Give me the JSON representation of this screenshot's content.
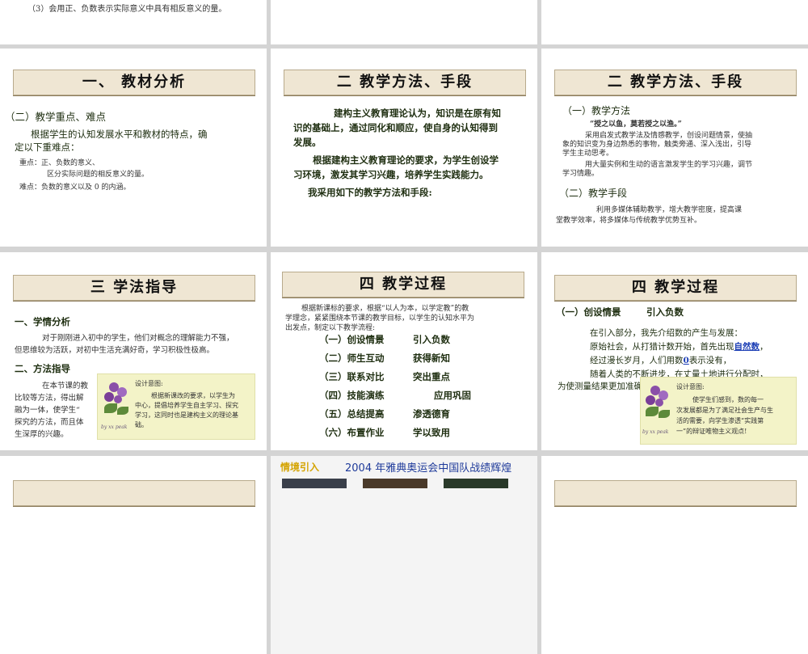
{
  "r0": {
    "line": "（3）会用正、负数表示实际意义中具有相反意义的量。"
  },
  "s1": {
    "title": "一、 教材分析",
    "heading": "（二）教学重点、难点",
    "p1": "根据学生的认知发展水平和教材的特点，确",
    "p2": "定以下重难点：",
    "k1": "重点：正、负数的意义、",
    "k2": "区分实际问题的相反意义的量。",
    "k3": "难点：负数的意义以及 0 的内涵。"
  },
  "s2": {
    "title": "二 教学方法、手段",
    "l1": "建构主义教育理论认为，知识是在原有知",
    "l2": "识的基础上，通过同化和顺应，使自身的认知得到",
    "l3": "发展。",
    "l4": "根据建构主义教育理论的要求，为学生创设学",
    "l5": "习环境，激发其学习兴趣，培养学生实践能力。",
    "l6": "我采用如下的教学方法和手段:"
  },
  "s3": {
    "title": "二 教学方法、手段",
    "h1": "（一）教学方法",
    "q": "“授之以鱼，莫若授之以渔。”",
    "a1": "采用启发式教学法及情感教学，创设问题情景，使抽",
    "a2": "象的知识变为身边熟悉的事物，触类旁通、深入浅出，引导",
    "a3": "学生主动思考。",
    "a4": "用大量实例和生动的语言激发学生的学习兴趣，调节",
    "a5": "学习情趣。",
    "h2": "（二）教学手段",
    "b1": "利用多媒体辅助教学，增大教学密度，提高课",
    "b2": "堂教学效率，将多媒体与传统教学优势互补。"
  },
  "s4": {
    "title": "三 学法指导",
    "h1": "一、学情分析",
    "p1": "对于刚刚进入初中的学生，他们对概念的理解能力不强，",
    "p2": "但思维较为活跃，对初中生活充满好奇，学习积极性极高。",
    "h2": "二、方法指导",
    "m1": "在本节课的教",
    "m2": "比较等方法，得出解",
    "m3": "融为一体，使学生“",
    "m4": "探究的方法，而且体",
    "m5": "生深厚的兴趣。",
    "note_title": "设计意图:",
    "note1": "根据新课改的要求，以学生为",
    "note2": "中心，提倡培养学生自主学习、探究",
    "note3": "学习，这同时也是建构主义的理论基",
    "note4": "础。",
    "sig": "by xx peak"
  },
  "s5": {
    "title": "四 教学过程",
    "i1": "根据新课标的要求，根据“以人为本，以学定教”的教",
    "i2": "学理念，紧紧围绕本节课的教学目标，以学生的认知水平为",
    "i3": "出发点，制定以下教学流程:",
    "steps": [
      {
        "n": "（一）创设情景",
        "d": "引入负数"
      },
      {
        "n": "（二）师生互动",
        "d": "获得新知"
      },
      {
        "n": "（三）联系对比",
        "d": "突出重点"
      },
      {
        "n": "（四）技能演练",
        "d": "应用巩固"
      },
      {
        "n": "（五）总结提高",
        "d": "渗透德育"
      },
      {
        "n": "（六）布置作业",
        "d": "学以致用"
      }
    ]
  },
  "s6": {
    "title": "四 教学过程",
    "h": "（一）创设情景",
    "h2": "引入负数",
    "l1": "在引入部分，我先介绍数的产生与发展：",
    "l2a": "原始社会，从打猎计数开始，首先出现",
    "l2b": "自然数",
    "l2c": "，",
    "l3a": "经过漫长岁月，人们用数",
    "l3b": "0",
    "l3c": "表示没有，",
    "l4": "随着人类的不断进步，在丈量土地进行分配时，",
    "l5": "为使测量结果更加准确",
    "note_title": "设计意图:",
    "note1": "使学生们感到，数的每一",
    "note2": "次发展都是为了满足社会生产与生",
    "note3": "活的需要，向学生渗透“实践第",
    "note4": "一”的辩证唯物主义观点!",
    "sig": "by xx peak"
  },
  "s8": {
    "label": "情境引入",
    "caption": "2004 年雅典奥运会中国队战绩辉煌"
  },
  "colors": {
    "title_bg": "#efe6d3",
    "note_bg": "#f3f3c8",
    "link": "#1d3fb5",
    "accent": "#c8a000"
  }
}
